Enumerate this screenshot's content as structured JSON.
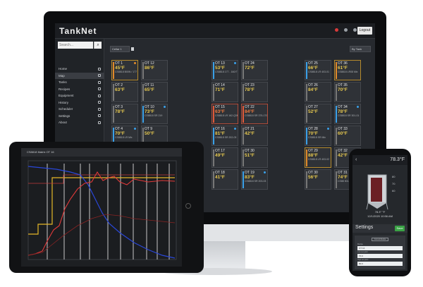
{
  "app": {
    "logo": "TankNet",
    "logout_label": "Logout",
    "search_placeholder": "Search...",
    "filter_label": "Cellar 1",
    "sort_label": "By Tank"
  },
  "nav": [
    {
      "label": "Home",
      "icon": "home-icon"
    },
    {
      "label": "Map",
      "icon": "map-icon"
    },
    {
      "label": "Tanks",
      "icon": "tank-icon"
    },
    {
      "label": "Recipes",
      "icon": "recipe-icon"
    },
    {
      "label": "Equipment",
      "icon": "equipment-icon"
    },
    {
      "label": "History",
      "icon": "history-icon"
    },
    {
      "label": "Scheduler",
      "icon": "calendar-icon"
    },
    {
      "label": "Settings",
      "icon": "gear-icon"
    },
    {
      "label": "About",
      "icon": "info-icon"
    }
  ],
  "tanks": [
    {
      "name": "OT 1",
      "temp": "45°F",
      "info": "CS8818 B00N / 177 - 4",
      "bar": "#e08a2a",
      "style": "warn",
      "dot": "orange"
    },
    {
      "name": "OT 12",
      "temp": "86°F",
      "info": "",
      "bar": "#777"
    },
    {
      "name": "OT 13",
      "temp": "53°F",
      "info": "CS8818 177 - 160/77 KD",
      "bar": "#3aa0e8",
      "dot": "blue"
    },
    {
      "name": "OT 24",
      "temp": "72°F",
      "info": "",
      "bar": "#777"
    },
    {
      "name": "OT 25",
      "temp": "66°F",
      "info": "CS8818 LR 403-01",
      "bar": "#3aa0e8"
    },
    {
      "name": "OT 36",
      "temp": "61°F",
      "info": "CS8818 LR08 Mix",
      "bar": "#e08a2a",
      "style": "warn"
    },
    {
      "name": "OT 2",
      "temp": "63°F",
      "info": "",
      "bar": "#777"
    },
    {
      "name": "OT 11",
      "temp": "65°F",
      "info": "",
      "bar": "#777"
    },
    {
      "name": "OT 14",
      "temp": "71°F",
      "info": "",
      "bar": "#777"
    },
    {
      "name": "OT 23",
      "temp": "78°F",
      "info": "",
      "bar": "#777"
    },
    {
      "name": "OT 26",
      "temp": "84°F",
      "info": "",
      "bar": "#777"
    },
    {
      "name": "OT 35",
      "temp": "70°F",
      "info": "",
      "bar": "#777"
    },
    {
      "name": "OT 3",
      "temp": "78°F",
      "info": "",
      "bar": "#777"
    },
    {
      "name": "OT 10",
      "temp": "73°F",
      "info": "CS8818 SR 219",
      "bar": "#3aa0e8",
      "dot": "blue"
    },
    {
      "name": "OT 15",
      "temp": "63°F",
      "info": "CS8818 LR 162-Q3M",
      "bar": "#e05a3a",
      "style": "alarm",
      "hot": true
    },
    {
      "name": "OT 22",
      "temp": "84°F",
      "info": "CS8818 SR 375-17062",
      "bar": "#e05a3a",
      "style": "alarm",
      "hot": true
    },
    {
      "name": "OT 27",
      "temp": "52°F",
      "info": "",
      "bar": "#777"
    },
    {
      "name": "OT 34",
      "temp": "78°F",
      "info": "CS8818 SR 301-01",
      "bar": "#3aa0e8",
      "dot": "blue"
    },
    {
      "name": "OT 4",
      "temp": "70°F",
      "info": "CS8818 LR Mix",
      "bar": "#3aa0e8",
      "dot": "blue"
    },
    {
      "name": "OT 9",
      "temp": "50°F",
      "info": "",
      "bar": "#777"
    },
    {
      "name": "OT 16",
      "temp": "81°F",
      "info": "CS8818 SR 202-03",
      "bar": "#3aa0e8",
      "dot": "blue"
    },
    {
      "name": "OT 21",
      "temp": "42°F",
      "info": "",
      "bar": "#777"
    },
    {
      "name": "OT 28",
      "temp": "70°F",
      "info": "CS8818 SR Mix",
      "bar": "#3aa0e8",
      "dot": "blue"
    },
    {
      "name": "OT 33",
      "temp": "60°F",
      "info": "",
      "bar": "#777"
    },
    {
      "name": "OT 17",
      "temp": "49°F",
      "info": "",
      "bar": "#777"
    },
    {
      "name": "OT 30",
      "temp": "51°F",
      "info": "",
      "bar": "#777"
    },
    {
      "name": "OT 29",
      "temp": "88°F",
      "info": "CS8818 LR 403-02",
      "bar": "#e08a2a",
      "style": "warn"
    },
    {
      "name": "OT 32",
      "temp": "42°F",
      "info": "",
      "bar": "#777"
    },
    {
      "name": "OT 18",
      "temp": "41°F",
      "info": "",
      "bar": "#777"
    },
    {
      "name": "OT 19",
      "temp": "83°F",
      "info": "CS8818 SR 203-03",
      "bar": "#3aa0e8",
      "dot": "blue"
    },
    {
      "name": "OT 30",
      "temp": "56°F",
      "info": "",
      "bar": "#777"
    },
    {
      "name": "OT 31",
      "temp": "74°F",
      "info": "CS88 501-",
      "bar": "#777"
    }
  ],
  "tablet": {
    "header": "CS8818 Matrix OT 16"
  },
  "phone": {
    "back": "‹",
    "temp": "78.3°F",
    "set_high": "80",
    "set_mid": "70",
    "set_low": "60",
    "readout_line1": "78.3° °F",
    "readout_line2": "12/1/2020 10:56 AM",
    "settings_title": "Settings",
    "save_label": "Save",
    "form_button": "Current Recipe",
    "fields": [
      {
        "label": "Recipe",
        "value": "OT 16"
      },
      {
        "label": "Low set point",
        "value": "70.0"
      },
      {
        "label": "High set point",
        "value": "80.0"
      }
    ]
  },
  "colors": {
    "accent_blue": "#3aa0e8",
    "warn_orange": "#e08a2a",
    "alarm_red": "#e05a3a",
    "temp_yellow": "#e7c94f"
  }
}
